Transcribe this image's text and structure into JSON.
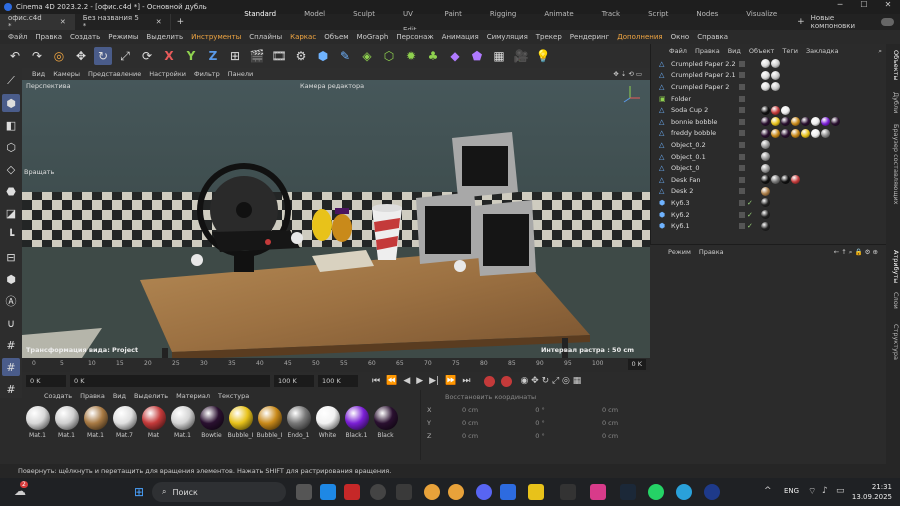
{
  "window": {
    "title": "Cinema 4D 2023.2.2 - [офис.c4d *] - Основной дубль"
  },
  "tabs": [
    {
      "label": "офис.c4d *"
    },
    {
      "label": "Без названия 5 *"
    }
  ],
  "layouts": [
    "Standard",
    "Model",
    "Sculpt",
    "UV Edit",
    "Paint",
    "Rigging",
    "Animate",
    "Track",
    "Script",
    "Nodes",
    "Visualize"
  ],
  "new_layouts_label": "Новые компоновки",
  "menu": [
    "Файл",
    "Правка",
    "Создать",
    "Режимы",
    "Выделить",
    "Инструменты",
    "Сплайны",
    "Каркас",
    "Объем",
    "MoGraph",
    "Персонаж",
    "Анимация",
    "Симуляция",
    "Трекер",
    "Рендеринг",
    "Дополнения",
    "Окно",
    "Справка"
  ],
  "viewport_menu": [
    "Вид",
    "Камеры",
    "Представление",
    "Настройки",
    "Фильтр",
    "Панели"
  ],
  "viewport": {
    "label": "Перспектива",
    "camera": "Камера редактора",
    "rotate_hint": "Вращать",
    "transform": "Трансформация вида: Project",
    "grid": "Интервал растра : 50 cm"
  },
  "timeline": {
    "ticks": [
      "0",
      "5",
      "10",
      "15",
      "20",
      "25",
      "30",
      "35",
      "40",
      "45",
      "50",
      "55",
      "60",
      "65",
      "70",
      "75",
      "80",
      "85",
      "90",
      "95",
      "100"
    ],
    "current_frame": "0 K",
    "end_frame": "0 K"
  },
  "transport": {
    "start": "0 K",
    "current": "0 K",
    "end": "100 K",
    "max": "100 K"
  },
  "material_menu": [
    "Создать",
    "Правка",
    "Вид",
    "Выделить",
    "Материал",
    "Текстура"
  ],
  "materials": [
    {
      "name": "Mat.1",
      "color": "#d8d8d8"
    },
    {
      "name": "Mat.1",
      "color": "#cfcfcf"
    },
    {
      "name": "Mat.1",
      "color": "#a87a44"
    },
    {
      "name": "Mat.7",
      "color": "#e0e0e0"
    },
    {
      "name": "Mat",
      "color": "#c43a3a"
    },
    {
      "name": "Mat.1",
      "color": "#d4d4d4"
    },
    {
      "name": "Bowtie",
      "color": "#2a1030"
    },
    {
      "name": "Bubble_I",
      "color": "#e8c21a"
    },
    {
      "name": "Bubble_I",
      "color": "#c98a1a"
    },
    {
      "name": "Endo_1",
      "color": "#777"
    },
    {
      "name": "White",
      "color": "#f2f2f2"
    },
    {
      "name": "Black.1",
      "color": "#7b1fd6"
    },
    {
      "name": "Black",
      "color": "#2a1030"
    }
  ],
  "coords": {
    "header": "Восстановить координаты",
    "rows": [
      {
        "axis": "X",
        "pos": "0 cm",
        "rot": "0 °",
        "size": "0 cm"
      },
      {
        "axis": "Y",
        "pos": "0 cm",
        "rot": "0 °",
        "size": "0 cm"
      },
      {
        "axis": "Z",
        "pos": "0 cm",
        "rot": "0 °",
        "size": "0 cm"
      }
    ]
  },
  "status": "Повернуть: щёлкнуть и перетащить для вращения элементов. Нажать SHIFT для растрирования вращения.",
  "object_menu": [
    "Файл",
    "Правка",
    "Вид",
    "Объект",
    "Теги",
    "Закладка"
  ],
  "objects": [
    {
      "name": "Crumpled Paper 2.2",
      "icon": "mesh-icon",
      "tags": [
        "#ddd",
        "#ccc"
      ]
    },
    {
      "name": "Crumpled Paper 2.1",
      "icon": "mesh-icon",
      "tags": [
        "#ddd",
        "#ccc"
      ]
    },
    {
      "name": "Crumpled Paper 2",
      "icon": "mesh-icon",
      "tags": [
        "#ddd",
        "#ccc"
      ]
    },
    {
      "name": "Folder",
      "icon": "folder-icon",
      "tags": []
    },
    {
      "name": "Soda Cup 2",
      "icon": "mesh-icon",
      "tags": [
        "#111",
        "#c43a3a",
        "#eee"
      ]
    },
    {
      "name": "bonnie bobble",
      "icon": "mesh-icon",
      "tags": [
        "#2a1030",
        "#e8c21a",
        "#2a1030",
        "#c98a1a",
        "#2a1030",
        "#eee",
        "#7b1fd6",
        "#2a1030"
      ]
    },
    {
      "name": "freddy bobble",
      "icon": "mesh-icon",
      "tags": [
        "#2a1030",
        "#c98a1a",
        "#2a1030",
        "#c98a1a",
        "#e8c21a",
        "#eee",
        "#888"
      ]
    },
    {
      "name": "Object_0.2",
      "icon": "mesh-icon",
      "tags": [
        "#999"
      ]
    },
    {
      "name": "Object_0.1",
      "icon": "mesh-icon",
      "tags": [
        "#999"
      ]
    },
    {
      "name": "Object_0",
      "icon": "mesh-icon",
      "tags": [
        "#999"
      ]
    },
    {
      "name": "Desk Fan",
      "icon": "mesh-icon",
      "tags": [
        "#111",
        "#777",
        "#111",
        "#c43a3a"
      ]
    },
    {
      "name": "Desk 2",
      "icon": "mesh-icon",
      "tags": [
        "#a87a44"
      ]
    },
    {
      "name": "Куб.3",
      "icon": "cube-icon",
      "tags": [
        "#222"
      ]
    },
    {
      "name": "Куб.2",
      "icon": "cube-icon",
      "tags": [
        "#222"
      ]
    },
    {
      "name": "Куб.1",
      "icon": "cube-icon",
      "tags": [
        "#222"
      ]
    }
  ],
  "attr_menu": [
    "Режим",
    "Правка"
  ],
  "side_tabs": [
    "Объекты",
    "Дубли",
    "Браузер составляющих",
    "Атрибуты",
    "Слои",
    "Структура"
  ],
  "taskbar": {
    "search": "Поиск",
    "lang": "ENG",
    "time": "21:31",
    "date": "13.09.2025",
    "badge": "2"
  }
}
